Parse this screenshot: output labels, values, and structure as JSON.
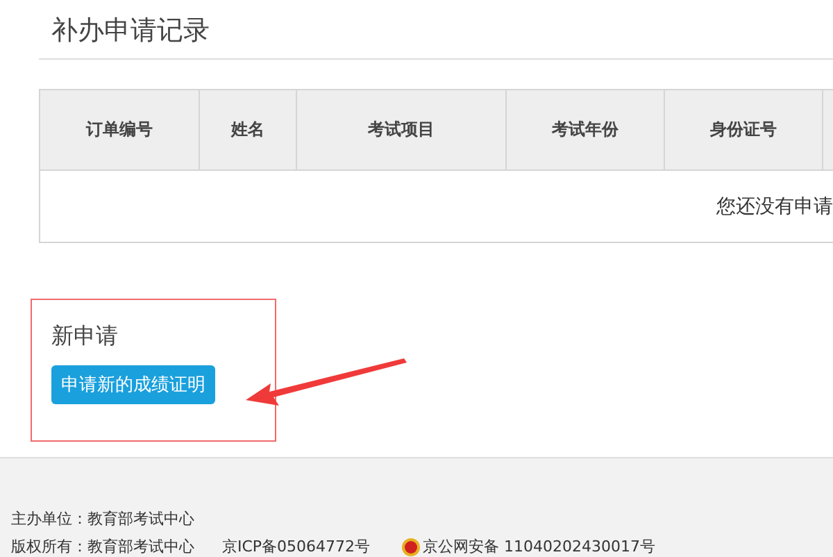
{
  "section_title": "补办申请记录",
  "table": {
    "columns": [
      "订单编号",
      "姓名",
      "考试项目",
      "考试年份",
      "身份证号"
    ],
    "empty_message": "您还没有申请"
  },
  "new_application": {
    "title": "新申请",
    "button": "申请新的成绩证明"
  },
  "footer": {
    "sponsor": "主办单位：教育部考试中心",
    "copyright": "版权所有：教育部考试中心",
    "icp": "京ICP备05064772号",
    "police": "京公网安备 11040202430017号"
  }
}
